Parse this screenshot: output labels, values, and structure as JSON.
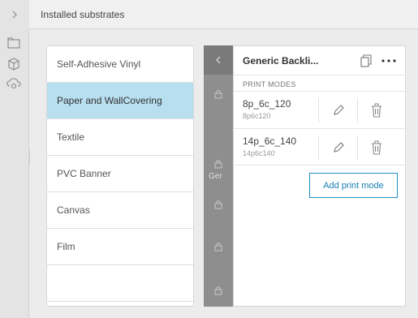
{
  "header": {
    "title": "Installed substrates"
  },
  "substrates": {
    "items": [
      {
        "label": "Self-Adhesive Vinyl",
        "selected": false
      },
      {
        "label": "Paper and WallCovering",
        "selected": true
      },
      {
        "label": "Textile",
        "selected": false
      },
      {
        "label": "PVC Banner",
        "selected": false
      },
      {
        "label": "Canvas",
        "selected": false
      },
      {
        "label": "Film",
        "selected": false
      },
      {
        "label": "",
        "selected": false
      }
    ]
  },
  "strip": {
    "partial_label": "Ger"
  },
  "detail": {
    "title": "Generic Backli...",
    "section_label": "PRINT MODES",
    "modes": [
      {
        "name": "8p_6c_120",
        "code": "8p6c120"
      },
      {
        "name": "14p_6c_140",
        "code": "14p6c140"
      }
    ],
    "add_label": "Add print mode"
  },
  "colors": {
    "selected": "#b8dff0",
    "accent": "#1f8fc6",
    "strip": "#8e8e8e"
  }
}
